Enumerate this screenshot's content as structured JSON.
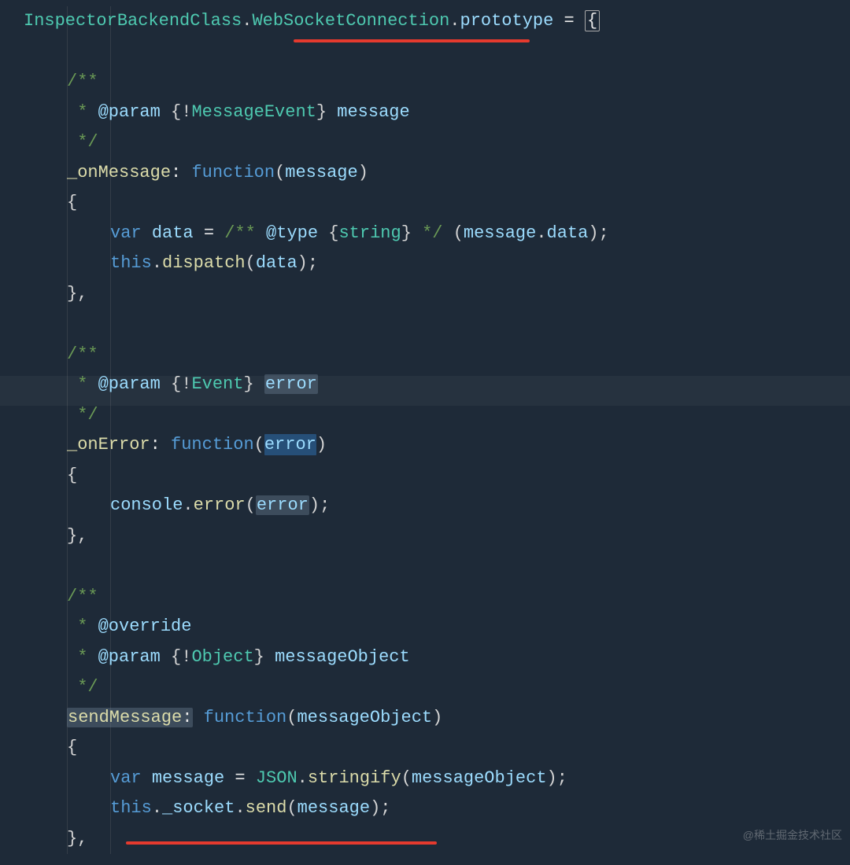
{
  "watermark": "@稀土掘金技术社区",
  "tokens": {
    "class1": "InspectorBackendClass",
    "class2": "WebSocketConnection",
    "prototype": "prototype",
    "eq": " = ",
    "lbrace": "{",
    "docOpen": "/**",
    "docStar": " * ",
    "docClose": " */",
    "paramTag": "@param",
    "typeTag": "@type",
    "overrideTag": "@override",
    "bang": "!",
    "tMessageEvent": "MessageEvent",
    "tEvent": "Event",
    "tObject": "Object",
    "tString": "string",
    "mOnMessage": "_onMessage",
    "mOnError": "_onError",
    "mSendMessage": "sendMessage",
    "colon": ": ",
    "kwFunction": "function",
    "kwVar": "var",
    "kwThis": "this",
    "pMessage": "message",
    "pError": "error",
    "pMessageObject": "messageObject",
    "vData": "data",
    "dispatch": "dispatch",
    "console": "console",
    "errorFn": "error",
    "JSON": "JSON",
    "stringify": "stringify",
    "socket": "_socket",
    "send": "send",
    "lparen": "(",
    "rparen": ")",
    "lcurl": "{",
    "rcurl": "}",
    "comma": ",",
    "semi": ";",
    "dot": ".",
    "assign": " = "
  }
}
